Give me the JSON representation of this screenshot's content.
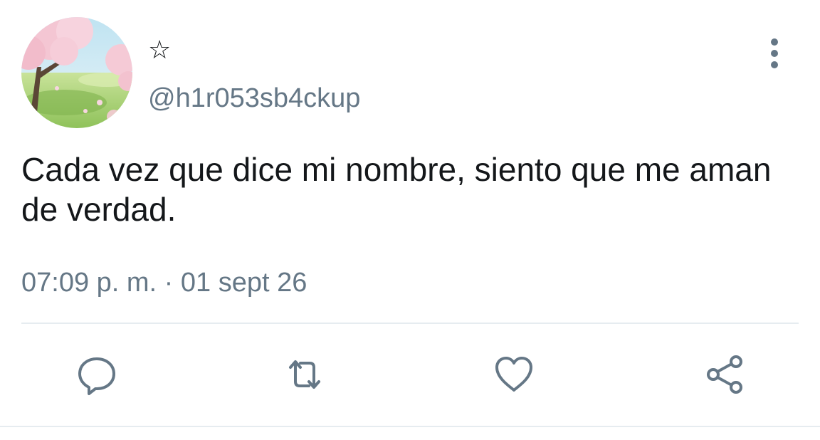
{
  "user": {
    "display_name": "☆",
    "handle": "@h1r053sb4ckup"
  },
  "tweet": {
    "text": "Cada vez que dice mi nombre, siento que me aman de verdad.",
    "timestamp": "07:09 p. m. · 01 sept 26"
  },
  "actions": {
    "reply_icon": "reply-icon",
    "retweet_icon": "retweet-icon",
    "like_icon": "heart-icon",
    "share_icon": "share-icon"
  },
  "colors": {
    "text": "#14171a",
    "secondary": "#657786",
    "divider": "#e6ecf0"
  }
}
